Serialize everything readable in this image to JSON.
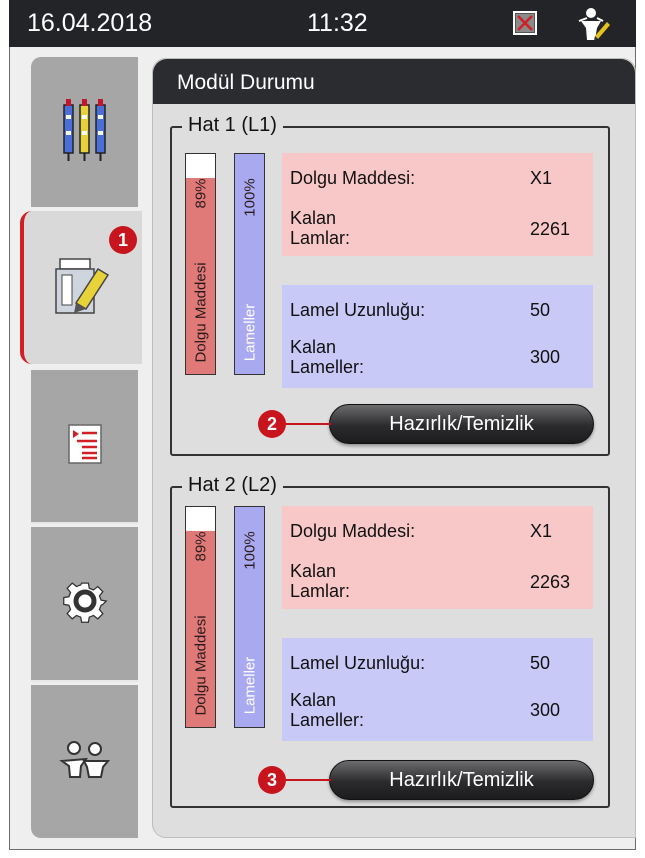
{
  "status_bar": {
    "date": "16.04.2018",
    "time": "11:32"
  },
  "sidebar": {
    "items": [
      {
        "name": "reagents",
        "icon": "reagent-vials-icon"
      },
      {
        "name": "module-status",
        "icon": "module-status-icon",
        "active": true
      },
      {
        "name": "programs",
        "icon": "program-list-icon"
      },
      {
        "name": "settings",
        "icon": "gear-icon"
      },
      {
        "name": "users",
        "icon": "user-group-icon"
      }
    ]
  },
  "panel": {
    "title": "Modül Durumu"
  },
  "lines": [
    {
      "title": "Hat 1 (L1)",
      "mounting_bar": {
        "label": "Dolgu Maddesi",
        "percent_label": "89%",
        "level": 0.89
      },
      "coverslip_bar": {
        "label": "Lameller",
        "percent_label": "100%",
        "level": 1.0
      },
      "mounting_medium_label": "Dolgu Maddesi:",
      "mounting_medium_value": "X1",
      "remaining_slides_label_1": "Kalan",
      "remaining_slides_label_2": "Lamlar:",
      "remaining_slides_value": "2261",
      "coverslip_length_label": "Lamel Uzunluğu:",
      "coverslip_length_value": "50",
      "remaining_coverslips_label_1": "Kalan",
      "remaining_coverslips_label_2": "Lameller:",
      "remaining_coverslips_value": "300",
      "button_label": "Hazırlık/Temizlik",
      "callout": "2"
    },
    {
      "title": "Hat 2 (L2)",
      "mounting_bar": {
        "label": "Dolgu Maddesi",
        "percent_label": "89%",
        "level": 0.89
      },
      "coverslip_bar": {
        "label": "Lameller",
        "percent_label": "100%",
        "level": 1.0
      },
      "mounting_medium_label": "Dolgu Maddesi:",
      "mounting_medium_value": "X1",
      "remaining_slides_label_1": "Kalan",
      "remaining_slides_label_2": "Lamlar:",
      "remaining_slides_value": "2263",
      "coverslip_length_label": "Lamel Uzunluğu:",
      "coverslip_length_value": "50",
      "remaining_coverslips_label_1": "Kalan",
      "remaining_coverslips_label_2": "Lameller:",
      "remaining_coverslips_value": "300",
      "button_label": "Hazırlık/Temizlik",
      "callout": "3"
    }
  ],
  "callout_tab": "1",
  "colors": {
    "accent_red": "#c8141c",
    "mounting_fill": "#e07a78",
    "coverslip_fill": "#a9a9ef",
    "red_panel": "#f8c8c8",
    "blue_panel": "#c9c9f7"
  }
}
